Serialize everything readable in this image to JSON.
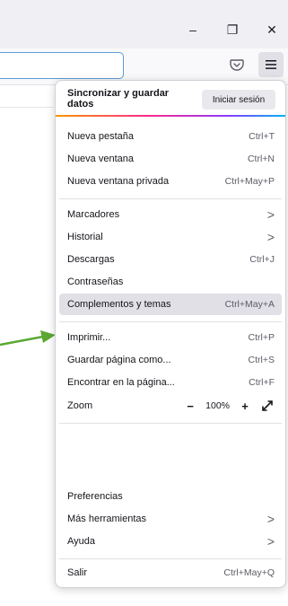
{
  "window_controls": {
    "minimize": "–",
    "maximize": "❐",
    "close": "✕"
  },
  "toolbar": {
    "icons": [
      "pocket-icon",
      "hamburger-menu-icon"
    ]
  },
  "menu": {
    "sync_label": "Sincronizar y guardar datos",
    "signin_label": "Iniciar sesión",
    "items": [
      {
        "label": "Nueva pestaña",
        "shortcut": "Ctrl+T"
      },
      {
        "label": "Nueva ventana",
        "shortcut": "Ctrl+N"
      },
      {
        "label": "Nueva ventana privada",
        "shortcut": "Ctrl+May+P"
      },
      {
        "label": "Marcadores",
        "shortcut": ">"
      },
      {
        "label": "Historial",
        "shortcut": ">"
      },
      {
        "label": "Descargas",
        "shortcut": "Ctrl+J"
      },
      {
        "label": "Contraseñas",
        "shortcut": ""
      },
      {
        "label": "Complementos y temas",
        "shortcut": "Ctrl+May+A"
      },
      {
        "label": "Imprimir...",
        "shortcut": "Ctrl+P"
      },
      {
        "label": "Guardar página como...",
        "shortcut": "Ctrl+S"
      },
      {
        "label": "Encontrar en la página...",
        "shortcut": "Ctrl+F"
      },
      {
        "label": "Zoom",
        "shortcut": ""
      },
      {
        "label": "Preferencias",
        "shortcut": ""
      },
      {
        "label": "Más herramientas",
        "shortcut": ">"
      },
      {
        "label": "Ayuda",
        "shortcut": ">"
      },
      {
        "label": "Salir",
        "shortcut": "Ctrl+May+Q"
      }
    ],
    "zoom": {
      "minus": "−",
      "value": "100%",
      "plus": "+",
      "fullscreen": "⤢"
    }
  },
  "colors": {
    "hover_bg": "#e0e0e6",
    "arrow": "#5aa832",
    "accent_url": "#5b9bd5"
  }
}
